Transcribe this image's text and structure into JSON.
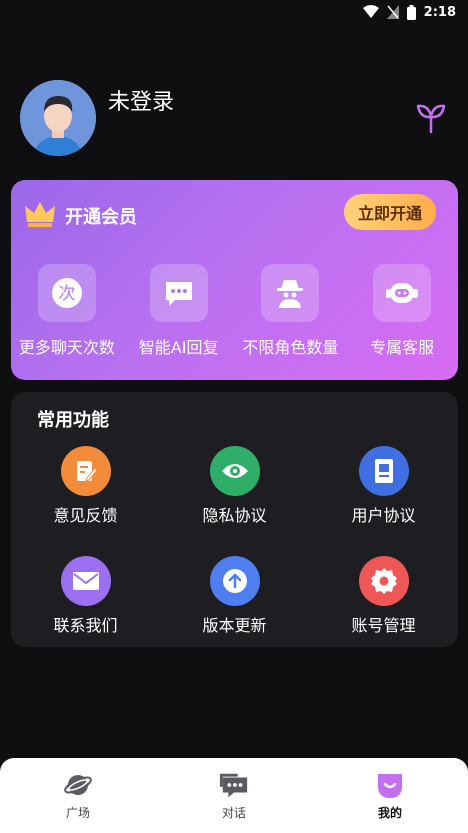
{
  "status_bar": {
    "time": "2:18",
    "icons": [
      "wifi-icon",
      "signal-off-icon",
      "battery-icon"
    ]
  },
  "profile": {
    "name": "未登录",
    "avatar": "avatar-icon",
    "action_icon": "sprout-icon"
  },
  "vip": {
    "title": "开通会员",
    "button": "立即开通",
    "perks": [
      {
        "label": "更多聊天次数",
        "icon": "count-icon"
      },
      {
        "label": "智能AI回复",
        "icon": "chat-dots-icon"
      },
      {
        "label": "不限角色数量",
        "icon": "spy-icon"
      },
      {
        "label": "专属客服",
        "icon": "robot-icon"
      }
    ],
    "gradient": [
      "#9a67ea",
      "#d86cf3"
    ]
  },
  "functions": {
    "title": "常用功能",
    "items": [
      {
        "label": "意见反馈",
        "icon": "feedback-icon",
        "color": "#f28c3b"
      },
      {
        "label": "隐私协议",
        "icon": "eye-icon",
        "color": "#2fae6a"
      },
      {
        "label": "用户协议",
        "icon": "document-icon",
        "color": "#3f6fe0"
      },
      {
        "label": "联系我们",
        "icon": "mail-icon",
        "color": "#9b70f0"
      },
      {
        "label": "版本更新",
        "icon": "upload-icon",
        "color": "#4f7ef0"
      },
      {
        "label": "账号管理",
        "icon": "settings-icon",
        "color": "#ef5656"
      }
    ]
  },
  "tabs": [
    {
      "label": "广场",
      "icon": "planet-icon",
      "active": false
    },
    {
      "label": "对话",
      "icon": "chat-icon",
      "active": false
    },
    {
      "label": "我的",
      "icon": "profile-tab-icon",
      "active": true
    }
  ]
}
